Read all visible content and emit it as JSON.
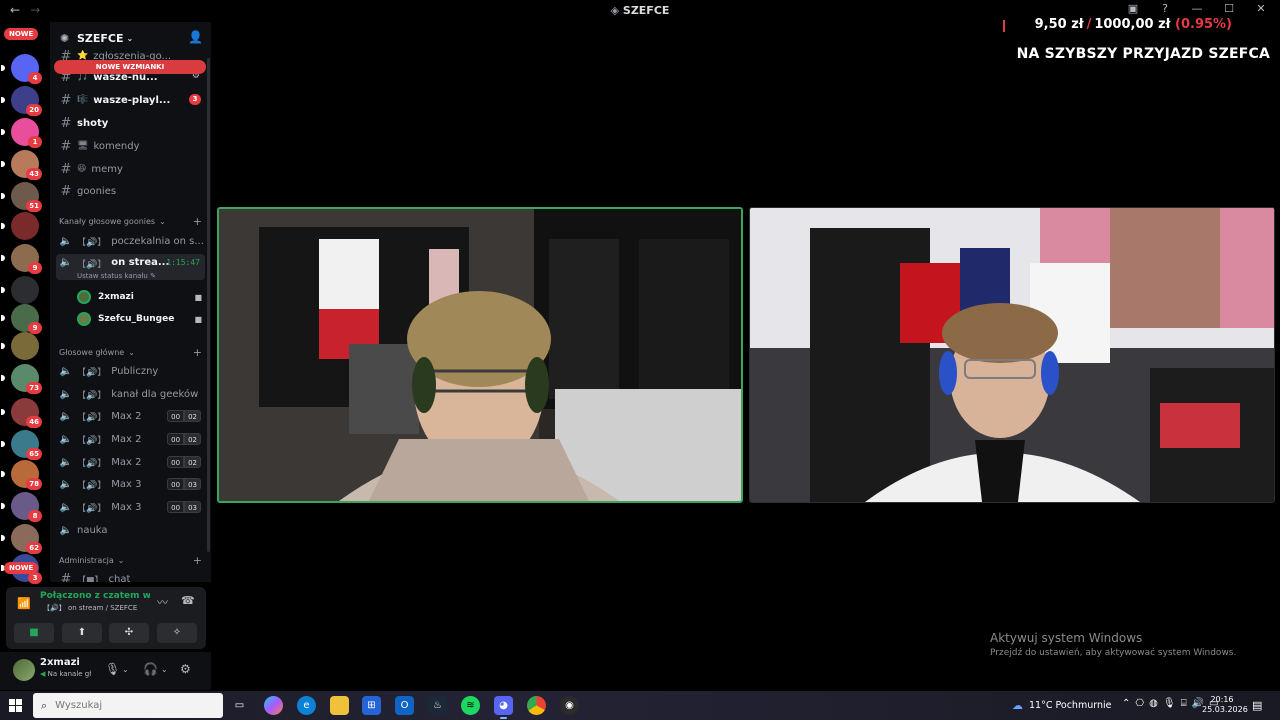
{
  "window": {
    "title": "SZEFCE",
    "nav_back": "←",
    "nav_forward": "→"
  },
  "server_rail": {
    "top_pill": "NOWE",
    "bottom_pill": "NOWE",
    "servers": [
      {
        "name": "server-1",
        "badge": "4",
        "color": "#5865f2"
      },
      {
        "name": "server-2",
        "badge": "20",
        "color": "#3d3f8a"
      },
      {
        "name": "server-3",
        "badge": "1",
        "color": "#e94e9c"
      },
      {
        "name": "server-4",
        "badge": "43",
        "color": "#b77a5a"
      },
      {
        "name": "server-5",
        "badge": "51",
        "color": "#6d5a4c"
      },
      {
        "name": "server-6",
        "badge": "",
        "color": "#7a2a2a"
      },
      {
        "name": "server-7",
        "badge": "9",
        "color": "#8c6b4e"
      },
      {
        "name": "server-8",
        "badge": "",
        "color": "#2b2d31"
      },
      {
        "name": "server-9",
        "badge": "9",
        "color": "#4a6b4a"
      },
      {
        "name": "server-10",
        "badge": "",
        "color": "#7a6a3a"
      },
      {
        "name": "server-11",
        "badge": "73",
        "color": "#5a8a6a"
      },
      {
        "name": "server-12",
        "badge": "46",
        "color": "#8a3a3a"
      },
      {
        "name": "server-13",
        "badge": "65",
        "color": "#3a7a8a"
      },
      {
        "name": "server-14",
        "badge": "78",
        "color": "#b86a3a"
      },
      {
        "name": "server-15",
        "badge": "8",
        "color": "#6a5a8a"
      },
      {
        "name": "server-16",
        "badge": "62",
        "color": "#8a6a5a"
      },
      {
        "name": "server-17",
        "badge": "3",
        "color": "#3a4a9a"
      }
    ]
  },
  "sidebar": {
    "server_name": "SZEFCE",
    "new_mentions": "NOWE WZMIANKI",
    "channels": [
      {
        "label": "zgłoszenia-go...",
        "deco": "⭐",
        "type": "text",
        "state": "muted"
      },
      {
        "label": "wasze-nu...",
        "deco": "🎵",
        "type": "text",
        "state": "unread"
      },
      {
        "label": "wasze-playl...",
        "deco": "🎼",
        "type": "text",
        "state": "unread",
        "count": "3"
      },
      {
        "label": "shoty",
        "deco": "",
        "type": "text",
        "state": "unread"
      },
      {
        "label": "komendy",
        "deco": "🖥",
        "type": "text",
        "state": "muted"
      },
      {
        "label": "memy",
        "deco": "😆",
        "type": "text",
        "state": "muted"
      },
      {
        "label": "goonies",
        "deco": "",
        "type": "text",
        "state": "muted"
      }
    ],
    "category_goonies": "Kanały głosowe goonies",
    "voice_channels_goonies": [
      {
        "label": "poczekalnia on s...",
        "type": "voice"
      },
      {
        "label": "on strea...",
        "type": "voice",
        "timer": "1:15:47",
        "status_hint": "Ustaw status kanału"
      }
    ],
    "members": [
      {
        "name": "2xmazi"
      },
      {
        "name": "Szefcu_Bungee"
      }
    ],
    "category_main": "Głosowe główne",
    "voice_channels_main": [
      {
        "label": "Publiczny"
      },
      {
        "label": "kanał dla geeków"
      },
      {
        "label": "Max 2",
        "a": "00",
        "b": "02"
      },
      {
        "label": "Max 2",
        "a": "00",
        "b": "02"
      },
      {
        "label": "Max 2",
        "a": "00",
        "b": "02"
      },
      {
        "label": "Max 3",
        "a": "00",
        "b": "03"
      },
      {
        "label": "Max 3",
        "a": "00",
        "b": "03"
      },
      {
        "label": "nauka"
      }
    ],
    "category_admin": "Administracja",
    "admin_channel": "chat"
  },
  "voice_panel": {
    "title": "Połączono z czatem wid",
    "subtitle": "on stream / SZEFCE"
  },
  "user_panel": {
    "name": "2xmazi",
    "status": "Na kanale gł"
  },
  "overlay": {
    "raised": "9,50 zł",
    "separator": "/",
    "goal": "1000,00 zł",
    "percent": "(0.95%)",
    "goal_text": "NA SZYBSZY PRZYJAZD SZEFCA"
  },
  "watermark": {
    "line1": "Aktywuj system Windows",
    "line2": "Przejdź do ustawień, aby aktywować system Windows."
  },
  "taskbar": {
    "search_placeholder": "Wyszukaj",
    "weather": "11°C  Pochmurnie",
    "time": "20:16",
    "date": "25.03.2026"
  }
}
